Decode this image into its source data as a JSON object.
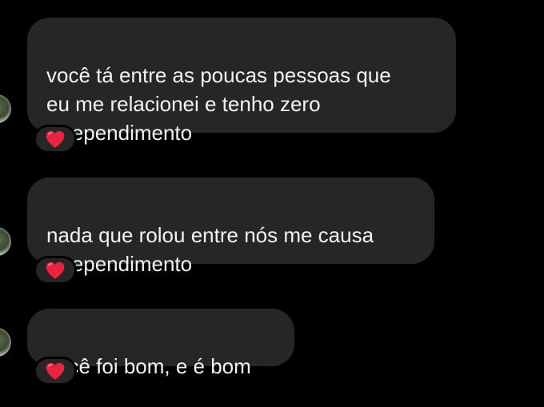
{
  "messages": [
    {
      "text": "você tá entre as poucas pessoas que\neu me relacionei e tenho zero\narrependimento",
      "reaction": "heart"
    },
    {
      "text": "nada que rolou entre nós me causa\narrependimento",
      "reaction": "heart"
    },
    {
      "text": "você foi bom, e é bom",
      "reaction": "heart"
    }
  ],
  "colors": {
    "background": "#000000",
    "bubble": "#262626",
    "text": "#f2f2f2",
    "heart": "#e8253d"
  },
  "icons": {
    "reaction": "red-heart-icon",
    "avatar": "contact-avatar"
  }
}
